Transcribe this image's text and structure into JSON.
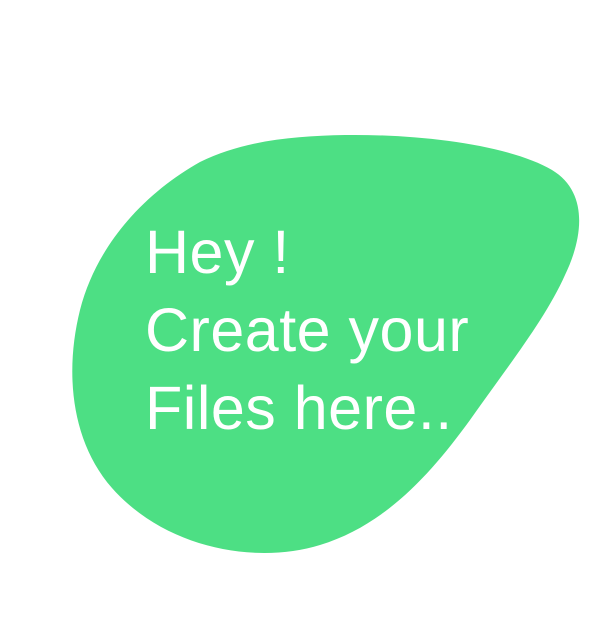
{
  "empty_state": {
    "line1": "Hey !",
    "line2": "Create your",
    "line3": "Files here.."
  },
  "colors": {
    "blob": "#4ddf84",
    "text": "#ffffff",
    "background": "#ffffff"
  },
  "icons": {
    "illustration": "green-blob-shape"
  }
}
